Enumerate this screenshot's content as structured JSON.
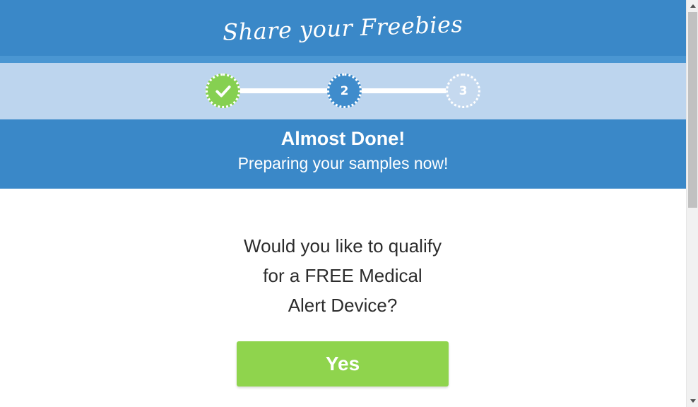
{
  "header": {
    "logo_text": "Share your Freebies"
  },
  "progress": {
    "steps": [
      {
        "label": "",
        "state": "complete",
        "icon": "check-icon"
      },
      {
        "label": "2",
        "state": "current"
      },
      {
        "label": "3",
        "state": "pending"
      }
    ]
  },
  "banner": {
    "title": "Almost Done!",
    "subtitle": "Preparing your samples now!"
  },
  "question": {
    "lines": [
      "Would you like to qualify",
      "for a FREE Medical",
      "Alert Device?"
    ]
  },
  "actions": {
    "yes_label": "Yes"
  },
  "colors": {
    "header_blue": "#3a88c8",
    "progress_bg": "#bdd5ee",
    "complete_green": "#86d051",
    "button_green": "#8fd44d"
  }
}
